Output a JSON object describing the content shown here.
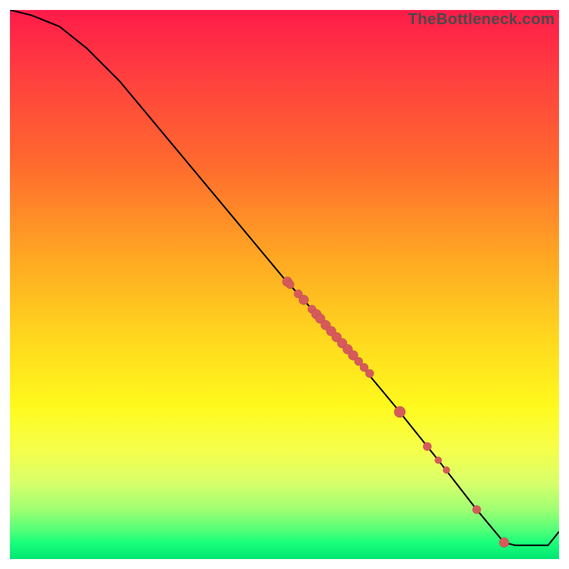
{
  "watermark": "TheBottleneck.com",
  "colors": {
    "curve": "#000000",
    "point": "#d65a5a"
  },
  "chart_data": {
    "type": "line",
    "title": "",
    "xlabel": "",
    "ylabel": "",
    "xlim": [
      0,
      100
    ],
    "ylim": [
      0,
      100
    ],
    "series": [
      {
        "name": "curve",
        "x": [
          0,
          4,
          9,
          14,
          20,
          30,
          40,
          50,
          60,
          70,
          78,
          85,
          90,
          92,
          95,
          98,
          100
        ],
        "y": [
          100,
          99,
          97,
          93,
          87,
          75,
          63,
          51,
          40,
          28,
          18,
          9,
          3,
          2.5,
          2.5,
          2.5,
          5
        ]
      }
    ],
    "points": [
      {
        "x": 50.5,
        "y": 50.5,
        "r": 7
      },
      {
        "x": 51.0,
        "y": 50.0,
        "r": 6
      },
      {
        "x": 52.5,
        "y": 48.3,
        "r": 6
      },
      {
        "x": 53.5,
        "y": 47.2,
        "r": 7
      },
      {
        "x": 55.0,
        "y": 45.5,
        "r": 6
      },
      {
        "x": 55.8,
        "y": 44.6,
        "r": 7
      },
      {
        "x": 56.5,
        "y": 43.8,
        "r": 7
      },
      {
        "x": 57.5,
        "y": 42.6,
        "r": 7
      },
      {
        "x": 58.5,
        "y": 41.5,
        "r": 7
      },
      {
        "x": 59.5,
        "y": 40.4,
        "r": 7
      },
      {
        "x": 60.5,
        "y": 39.3,
        "r": 7
      },
      {
        "x": 61.5,
        "y": 38.2,
        "r": 7
      },
      {
        "x": 62.5,
        "y": 37.1,
        "r": 7
      },
      {
        "x": 63.5,
        "y": 36.0,
        "r": 6
      },
      {
        "x": 64.5,
        "y": 34.9,
        "r": 6
      },
      {
        "x": 65.5,
        "y": 33.8,
        "r": 6
      },
      {
        "x": 71.0,
        "y": 26.8,
        "r": 8
      },
      {
        "x": 76.0,
        "y": 20.5,
        "r": 6
      },
      {
        "x": 78.0,
        "y": 18.0,
        "r": 5
      },
      {
        "x": 79.5,
        "y": 16.2,
        "r": 5
      },
      {
        "x": 85.0,
        "y": 9.0,
        "r": 6
      },
      {
        "x": 90.0,
        "y": 3.0,
        "r": 7
      }
    ]
  }
}
